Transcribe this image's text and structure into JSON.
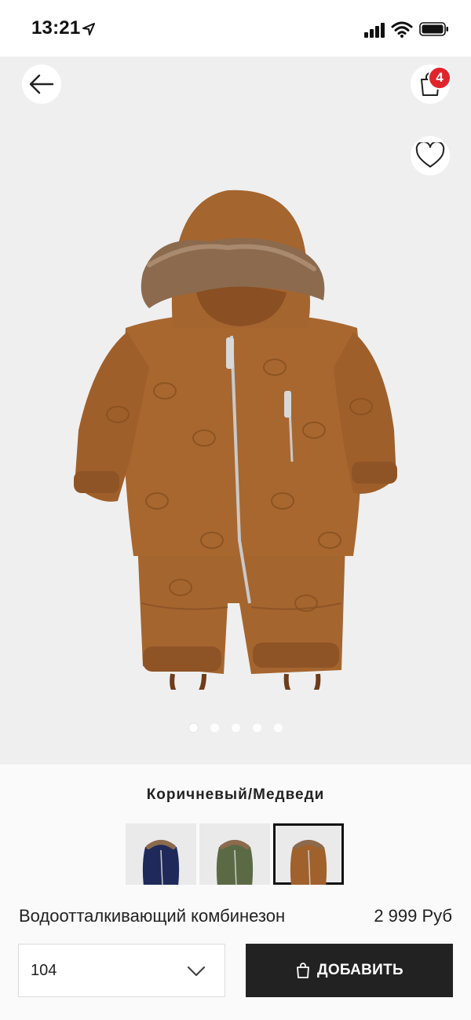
{
  "status_bar": {
    "time": "13:21",
    "icons": [
      "location-arrow-icon",
      "signal-icon",
      "wifi-icon",
      "battery-icon"
    ]
  },
  "header": {
    "back_icon": "arrow-left-icon",
    "bag_icon": "shopping-bag-icon",
    "bag_count": "4",
    "favorite_icon": "heart-outline-icon"
  },
  "gallery": {
    "image_count": 5,
    "active_index": 0
  },
  "product": {
    "color_name": "Коричневый/Медведи",
    "title": "Водоотталкивающий комбинезон",
    "price": "2 999 Руб",
    "swatches": [
      {
        "color": "#1f2a5a",
        "selected": false
      },
      {
        "color": "#5b6a45",
        "selected": false
      },
      {
        "color": "#a0612c",
        "selected": true
      }
    ]
  },
  "actions": {
    "size_value": "104",
    "add_label": "ДОБАВИТЬ"
  },
  "colors": {
    "badge": "#e0242c",
    "button": "#222222",
    "product_brown": "#a5652f"
  }
}
